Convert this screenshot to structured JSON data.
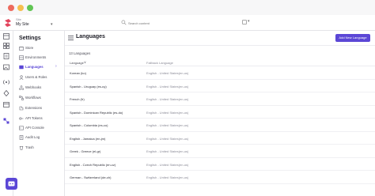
{
  "window": {
    "controls": [
      "close",
      "minimize",
      "maximize"
    ]
  },
  "topbar": {
    "site_label": "Site",
    "site_name": "My Site",
    "search_placeholder": "Search content",
    "extra_btn": "▾"
  },
  "rail": {
    "icons": [
      "layout-icon",
      "grid-icon",
      "pages-icon",
      "media-icon",
      "image-icon",
      "broadcast-icon",
      "pin-icon",
      "calendar-icon",
      "settings-icon",
      "puzzle-icon"
    ]
  },
  "settings": {
    "title": "Settings",
    "items": [
      {
        "label": "Store",
        "icon": "store-icon",
        "active": false
      },
      {
        "label": "Environments",
        "icon": "env-icon",
        "active": false
      },
      {
        "label": "Languages",
        "icon": "languages-icon",
        "active": true
      },
      {
        "label": "Users & Roles",
        "icon": "users-icon",
        "active": false
      },
      {
        "label": "Webhooks",
        "icon": "webhook-icon",
        "active": false
      },
      {
        "label": "Workflows",
        "icon": "workflow-icon",
        "active": false
      },
      {
        "label": "Extensions",
        "icon": "extensions-icon",
        "active": false
      },
      {
        "label": "API Tokens",
        "icon": "key-icon",
        "active": false
      },
      {
        "label": "API Console",
        "icon": "console-icon",
        "active": false
      },
      {
        "label": "Audit Log",
        "icon": "audit-icon",
        "active": false
      },
      {
        "label": "Trash",
        "icon": "trash-icon",
        "active": false
      }
    ],
    "active_chevron": "›"
  },
  "main": {
    "title": "Languages",
    "add_button": "Add New Language",
    "count_label": "13 Languages",
    "columns": [
      "Language",
      "Fallback Language"
    ],
    "sort_indicator": "∨",
    "rows": [
      {
        "language": "Korean (ko)",
        "fallback": "English - United States(en-us)"
      },
      {
        "language": "Spanish - Uruguay (es-uy)",
        "fallback": "English - United States(en-us)"
      },
      {
        "language": "French (fr)",
        "fallback": "English - United States(en-us)"
      },
      {
        "language": "Spanish - Dominican Republic (es-do)",
        "fallback": "English - United States(en-us)"
      },
      {
        "language": "Spanish - Colombia (es-co)",
        "fallback": "English - United States(en-us)"
      },
      {
        "language": "English - Jamaica (en-jm)",
        "fallback": "English - United States(en-us)"
      },
      {
        "language": "Greek - Greece (el-gr)",
        "fallback": "English - United States(en-us)"
      },
      {
        "language": "English - Czech Republic (en-cz)",
        "fallback": "English - United States(en-us)"
      },
      {
        "language": "German - Switzerland (de-ch)",
        "fallback": "English - United States(en-us)"
      }
    ]
  },
  "colors": {
    "accent": "#5b47d6",
    "logo": "#e2445c"
  }
}
